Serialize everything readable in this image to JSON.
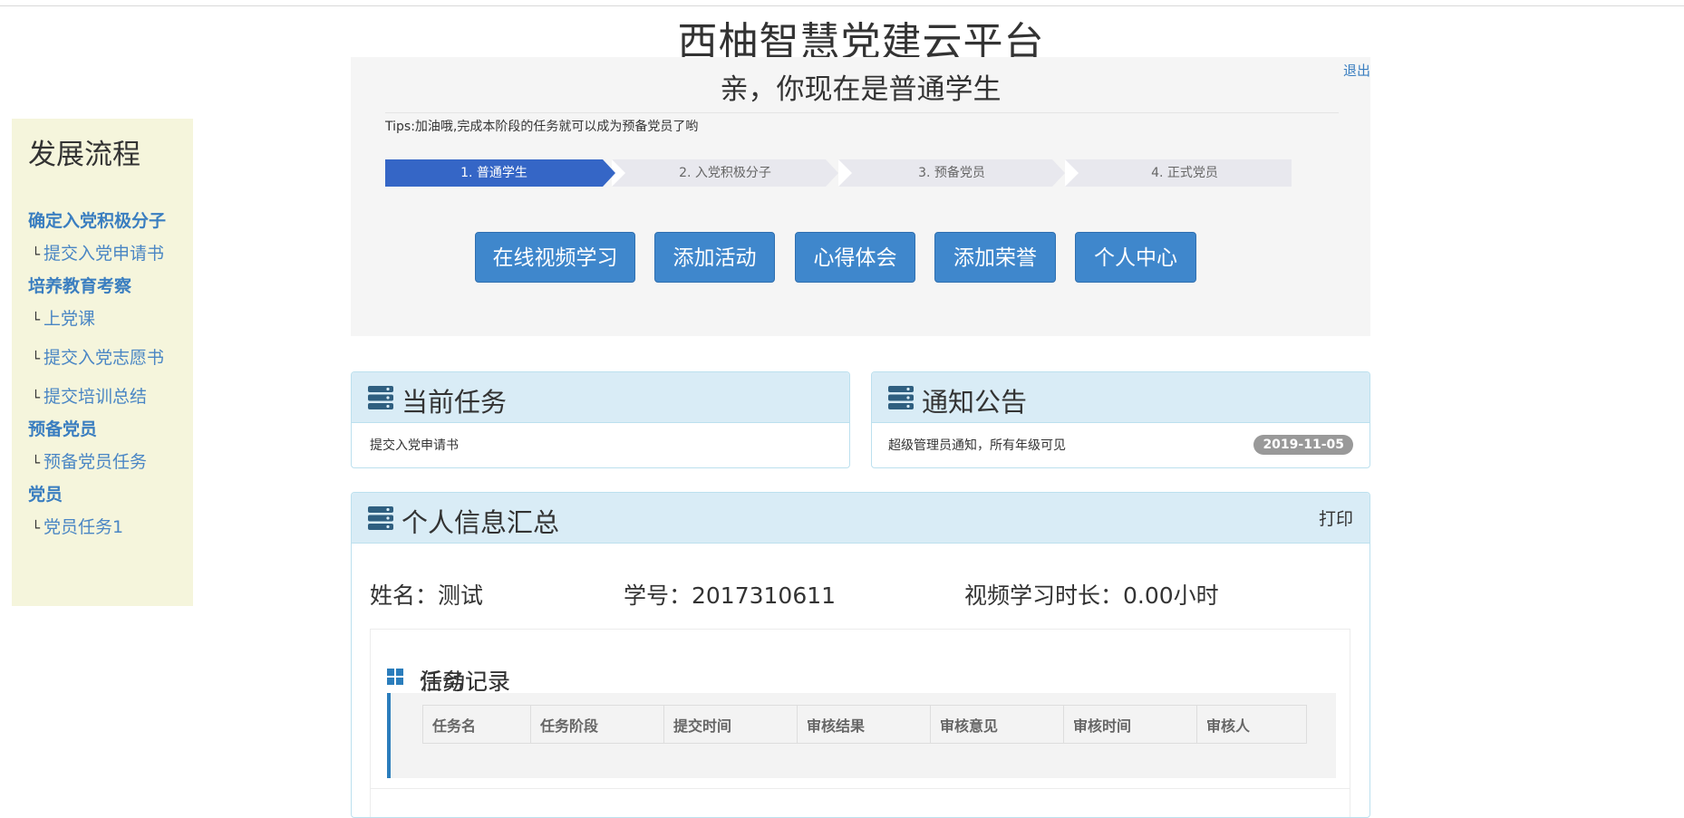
{
  "site_title": "西柚智慧党建云平台",
  "sidebar": {
    "title": "发展流程",
    "groups": [
      {
        "stage": "确定入党积极分子",
        "items": [
          "提交入党申请书"
        ]
      },
      {
        "stage": "培养教育考察",
        "items": [
          "上党课",
          "提交入党志愿书",
          "提交培训总结"
        ]
      },
      {
        "stage": "预备党员",
        "items": [
          "预备党员任务"
        ]
      },
      {
        "stage": "党员",
        "items": [
          "党员任务1"
        ]
      }
    ],
    "corner_glyph": "└"
  },
  "banner": {
    "logout": "退出",
    "role_title": "亲，你现在是普通学生",
    "tips": "Tips:加油哦,完成本阶段的任务就可以成为预备党员了哟",
    "steps": [
      "1. 普通学生",
      "2. 入党积极分子",
      "3. 预备党员",
      "4. 正式党员"
    ],
    "active_step": 1,
    "actions": [
      "在线视频学习",
      "添加活动",
      "心得体会",
      "添加荣誉",
      "个人中心"
    ]
  },
  "current_task": {
    "title": "当前任务",
    "item": "提交入党申请书"
  },
  "notice": {
    "title": "通知公告",
    "item": "超级管理员通知，所有年级可见",
    "date": "2019-11-05"
  },
  "summary": {
    "title": "个人信息汇总",
    "print": "打印",
    "name": "姓名：测试",
    "student_id": "学号：2017310611",
    "video_time": "视频学习时长：0.00小时",
    "task_record": {
      "title": "任务记录",
      "columns": [
        "任务名",
        "任务阶段",
        "提交时间",
        "审核结果",
        "审核意见",
        "审核时间",
        "审核人"
      ]
    },
    "activity_record": {
      "title": "活动记录"
    }
  },
  "colors": {
    "primary": "#3f87cc",
    "step_active": "#3566c6",
    "sidebar_bg": "#f5f5dc",
    "panel_head": "#d9ecf6",
    "link": "#3a7ec0"
  },
  "icons": [
    "list-server-icon",
    "grid-icon"
  ]
}
